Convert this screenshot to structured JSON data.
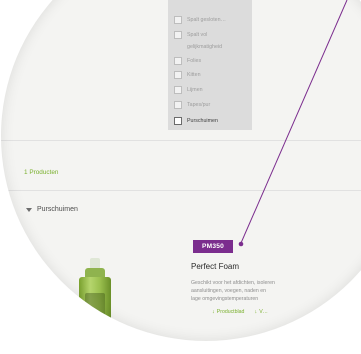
{
  "filters": {
    "items": [
      {
        "label": "Spalt gesloten…",
        "selected": false
      },
      {
        "label": "Spalt vol",
        "selected": false
      },
      {
        "label": "gelijkmatigheid",
        "selected": false
      },
      {
        "label": "Folies",
        "selected": false
      },
      {
        "label": "Kitten",
        "selected": false
      },
      {
        "label": "Lijmen",
        "selected": false
      },
      {
        "label": "Tapes/pur",
        "selected": false
      },
      {
        "label": "Purschuimen",
        "selected": true
      }
    ]
  },
  "results": {
    "count_label": "1 Producten",
    "category": "Purschuimen"
  },
  "product": {
    "badge": "PM350",
    "name": "Perfect Foam",
    "description_lines": [
      "Geschikt voor het afdichten, isoleren",
      "aansluitingen, voegen, naden en",
      "lage omgevingstemperaturen"
    ],
    "links": [
      {
        "label": "Productblad",
        "icon": "arrow-icon"
      },
      {
        "label": "V…",
        "icon": "arrow-icon"
      }
    ]
  },
  "colors": {
    "accent_green": "#7ab02e",
    "badge_purple": "#7b2d8e",
    "callout_line": "#7b2d8e"
  }
}
